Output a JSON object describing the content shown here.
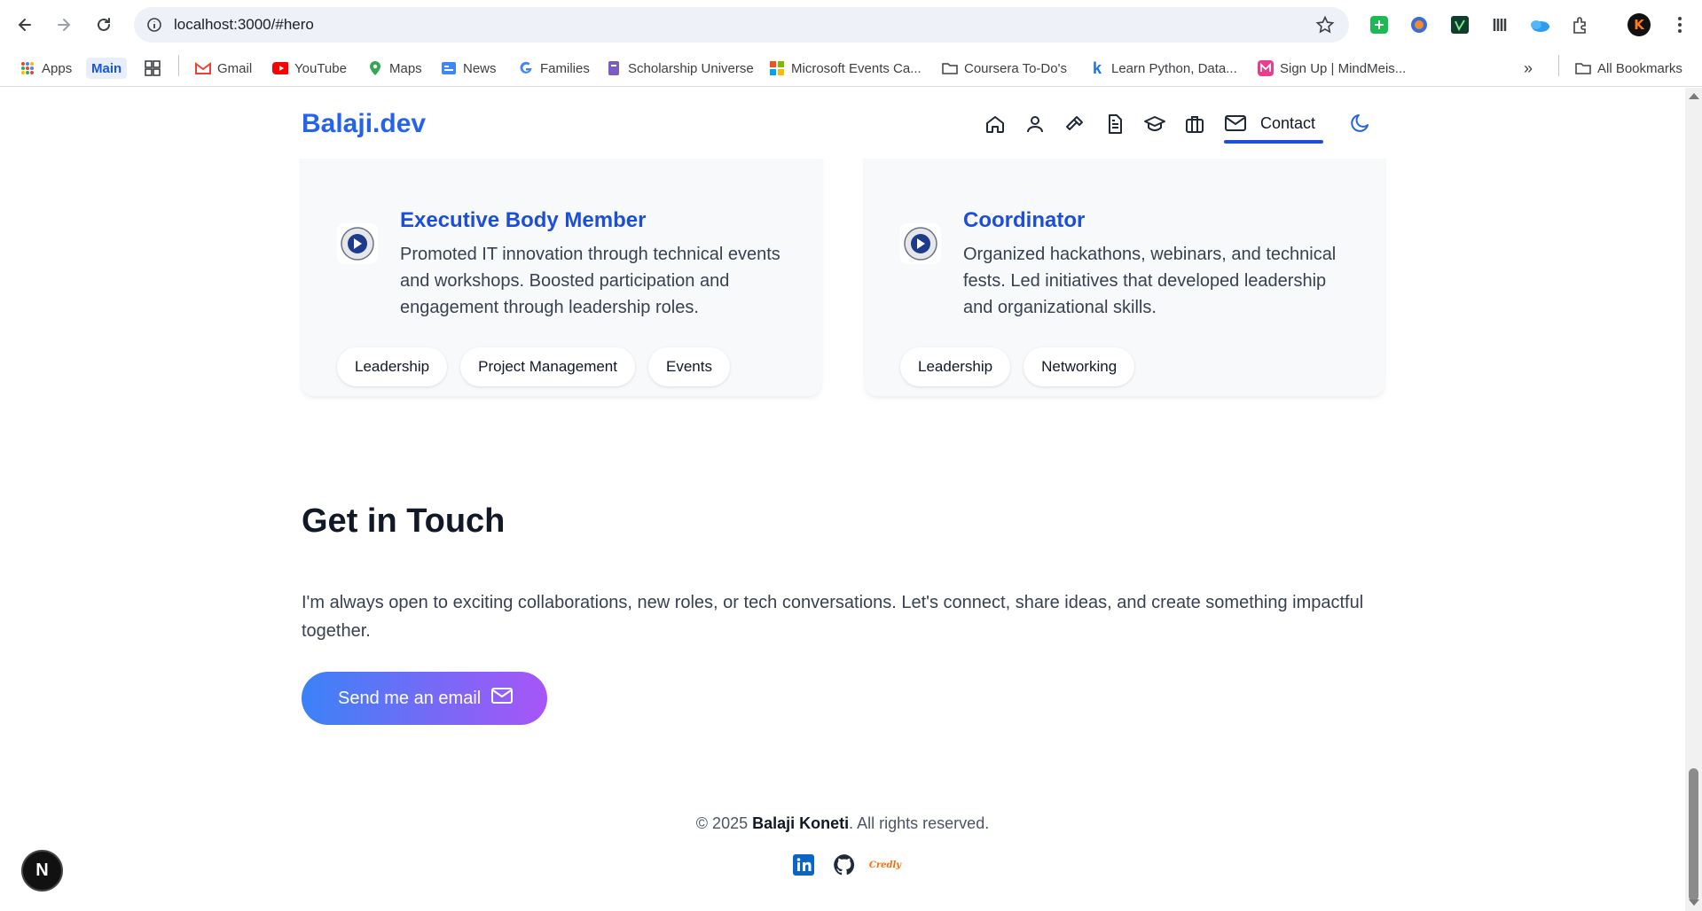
{
  "browser": {
    "url": "localhost:3000/#hero",
    "bookmarks": {
      "apps": "Apps",
      "main": "Main",
      "gmail": "Gmail",
      "youtube": "YouTube",
      "maps": "Maps",
      "news": "News",
      "families": "Families",
      "scholarship": "Scholarship Universe",
      "microsoft": "Microsoft Events Ca...",
      "coursera": "Coursera To-Do's",
      "learn_python": "Learn Python, Data...",
      "mindmeister": "Sign Up | MindMeis...",
      "all_bookmarks": "All Bookmarks"
    },
    "profile_initial": "K"
  },
  "header": {
    "brand": "Balaji.dev",
    "active_nav": "Contact"
  },
  "cards": [
    {
      "role": "Executive Body Member",
      "description": "Promoted IT innovation through technical events and workshops. Boosted participation and engagement through leadership roles.",
      "tags": [
        "Leadership",
        "Project Management",
        "Events"
      ]
    },
    {
      "role": "Coordinator",
      "description": "Organized hackathons, webinars, and technical fests. Led initiatives that developed leadership and organizational skills.",
      "tags": [
        "Leadership",
        "Networking"
      ]
    }
  ],
  "contact": {
    "title": "Get in Touch",
    "text": "I'm always open to exciting collaborations, new roles, or tech conversations. Let's connect, share ideas, and create something impactful together.",
    "button": "Send me an email"
  },
  "footer": {
    "copy_prefix": "© 2025 ",
    "name": "Balaji Koneti",
    "copy_suffix": ". All rights reserved.",
    "credly": "Credly"
  },
  "dev_badge": "N",
  "colors": {
    "brand": "#2563eb",
    "role": "#1d4ed8",
    "button_start": "#3b82f6",
    "button_end": "#a855f7"
  }
}
